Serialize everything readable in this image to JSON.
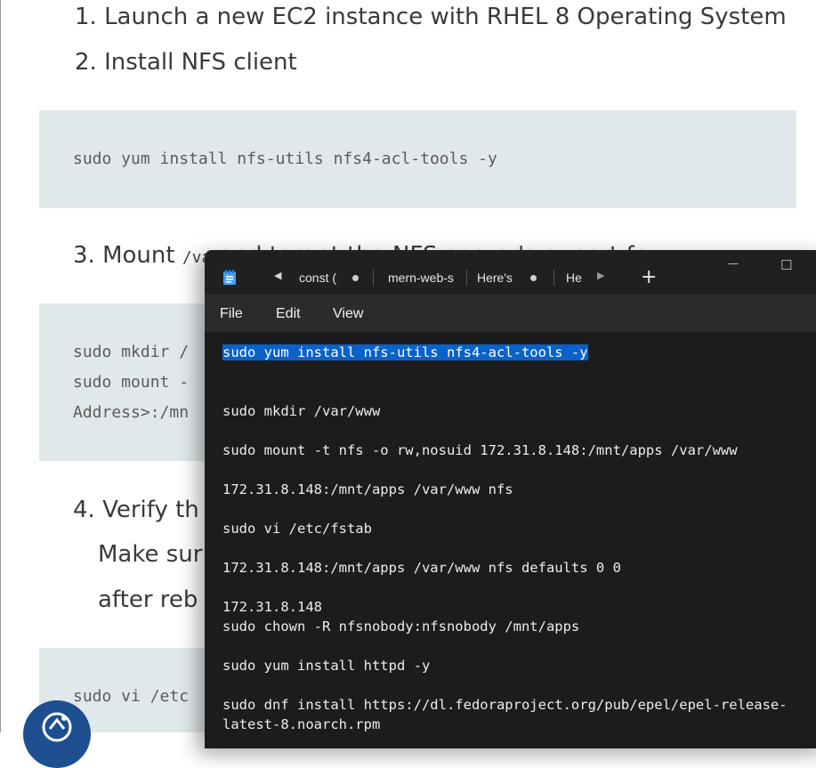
{
  "article": {
    "step1": "1. Launch a new EC2 instance with RHEL 8 Operating System",
    "step2": "2. Install NFS client",
    "code1": [
      "sudo yum install nfs-utils nfs4-acl-tools -y"
    ],
    "step3_prefix": "3. Mount",
    "step3_code": "/va",
    "step3_rest": "and target the NFS server's export fo",
    "code2": [
      "sudo mkdir /",
      "sudo mount -",
      "Address>:/mn"
    ],
    "step4_lines": [
      "4. Verify th",
      "Make sur",
      "after reb"
    ],
    "code3": [
      "sudo vi /etc"
    ],
    "fab_icon": "rocket-icon"
  },
  "notepad": {
    "app_icon": "notepad-icon",
    "tabs": [
      {
        "label": "const ("
      },
      {
        "label": "mern-web-s"
      },
      {
        "label": "Here's"
      },
      {
        "label": "He"
      }
    ],
    "new_tab": "+",
    "window_controls": {
      "minimize": "—",
      "maximize": "☐"
    },
    "menu": [
      "File",
      "Edit",
      "View"
    ],
    "lines": [
      "sudo yum install nfs-utils nfs4-acl-tools -y",
      "sudo mkdir /var/www",
      "sudo mount -t nfs -o rw,nosuid 172.31.8.148:/mnt/apps /var/www",
      "172.31.8.148:/mnt/apps /var/www nfs",
      "sudo vi /etc/fstab",
      "172.31.8.148:/mnt/apps /var/www nfs defaults 0 0",
      "172.31.8.148",
      "sudo chown -R nfsnobody:nfsnobody /mnt/apps",
      "sudo yum install httpd -y",
      "sudo dnf install https://dl.fedoraproject.org/pub/epel/epel-release-",
      "latest-8.noarch.rpm"
    ],
    "colors": {
      "selection": "#0a62c9",
      "editor_bg": "#1c1c1c"
    }
  }
}
